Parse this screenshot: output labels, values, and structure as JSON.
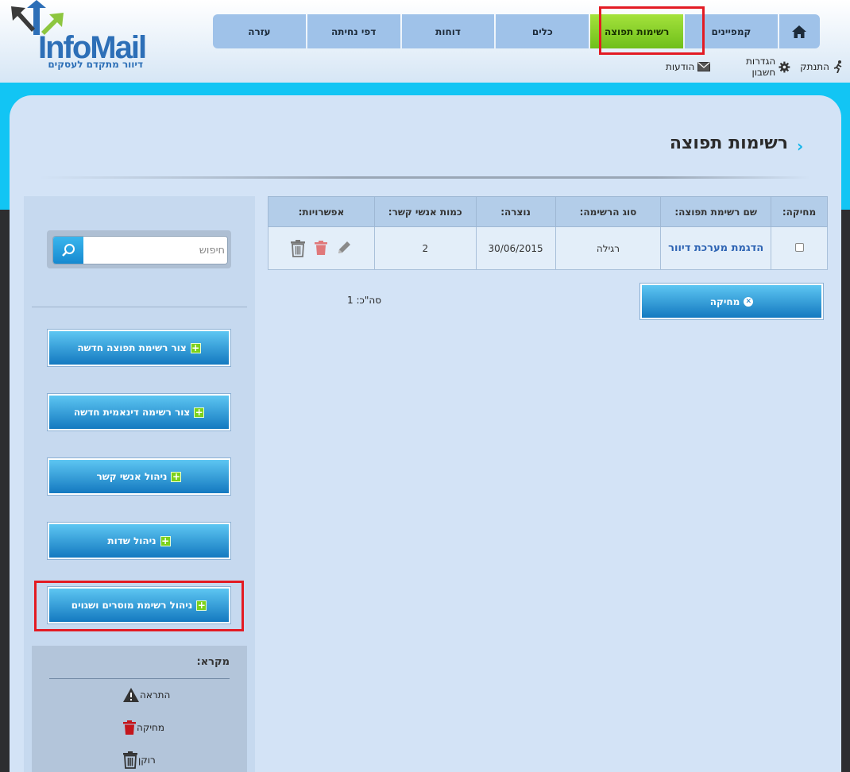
{
  "logo": {
    "brand": "InfoMail",
    "tagline": "דיוור מתקדם לעסקים"
  },
  "nav": {
    "home_icon": "home-icon",
    "items": [
      {
        "label": "קמפיינים"
      },
      {
        "label": "רשימות תפוצה",
        "active": true
      },
      {
        "label": "כלים"
      },
      {
        "label": "דוחות"
      },
      {
        "label": "דפי נחיתה"
      },
      {
        "label": "עזרה"
      }
    ]
  },
  "subnav": {
    "messages": "הודעות",
    "settings": "הגדרות חשבון",
    "logout": "התנתק"
  },
  "page": {
    "title": "רשימות תפוצה"
  },
  "table": {
    "headers": {
      "delete": "מחיקה:",
      "name": "שם רשימת תפוצה:",
      "type": "סוג הרשימה:",
      "created": "נוצרה:",
      "contacts": "כמות אנשי קשר:",
      "options": "אפשרויות:"
    },
    "rows": [
      {
        "name": "הדגמת מערכת דיוור",
        "type": "רגילה",
        "created": "30/06/2015",
        "contacts": "2"
      }
    ]
  },
  "actions": {
    "delete_label": "מחיקה",
    "total": "סה\"כ: 1"
  },
  "sidebar": {
    "search_placeholder": "חיפוש",
    "buttons": [
      {
        "label": "צור רשימת תפוצה חדשה"
      },
      {
        "label": "צור רשימה דינאמית חדשה"
      },
      {
        "label": "ניהול אנשי קשר"
      },
      {
        "label": "ניהול שדות"
      },
      {
        "label": "ניהול רשימת מוסרים ושגוים"
      }
    ]
  },
  "legend": {
    "title": "מקרא:",
    "items": [
      {
        "label": "התראה",
        "icon": "warning-icon"
      },
      {
        "label": "מחיקה",
        "icon": "delete-icon"
      },
      {
        "label": "רוקן",
        "icon": "empty-trash-icon"
      }
    ]
  },
  "colors": {
    "accent_cyan": "#12c5f4",
    "nav_active": "#8fd62c",
    "highlight_red": "#e31b23",
    "link_blue": "#2d63b3"
  }
}
